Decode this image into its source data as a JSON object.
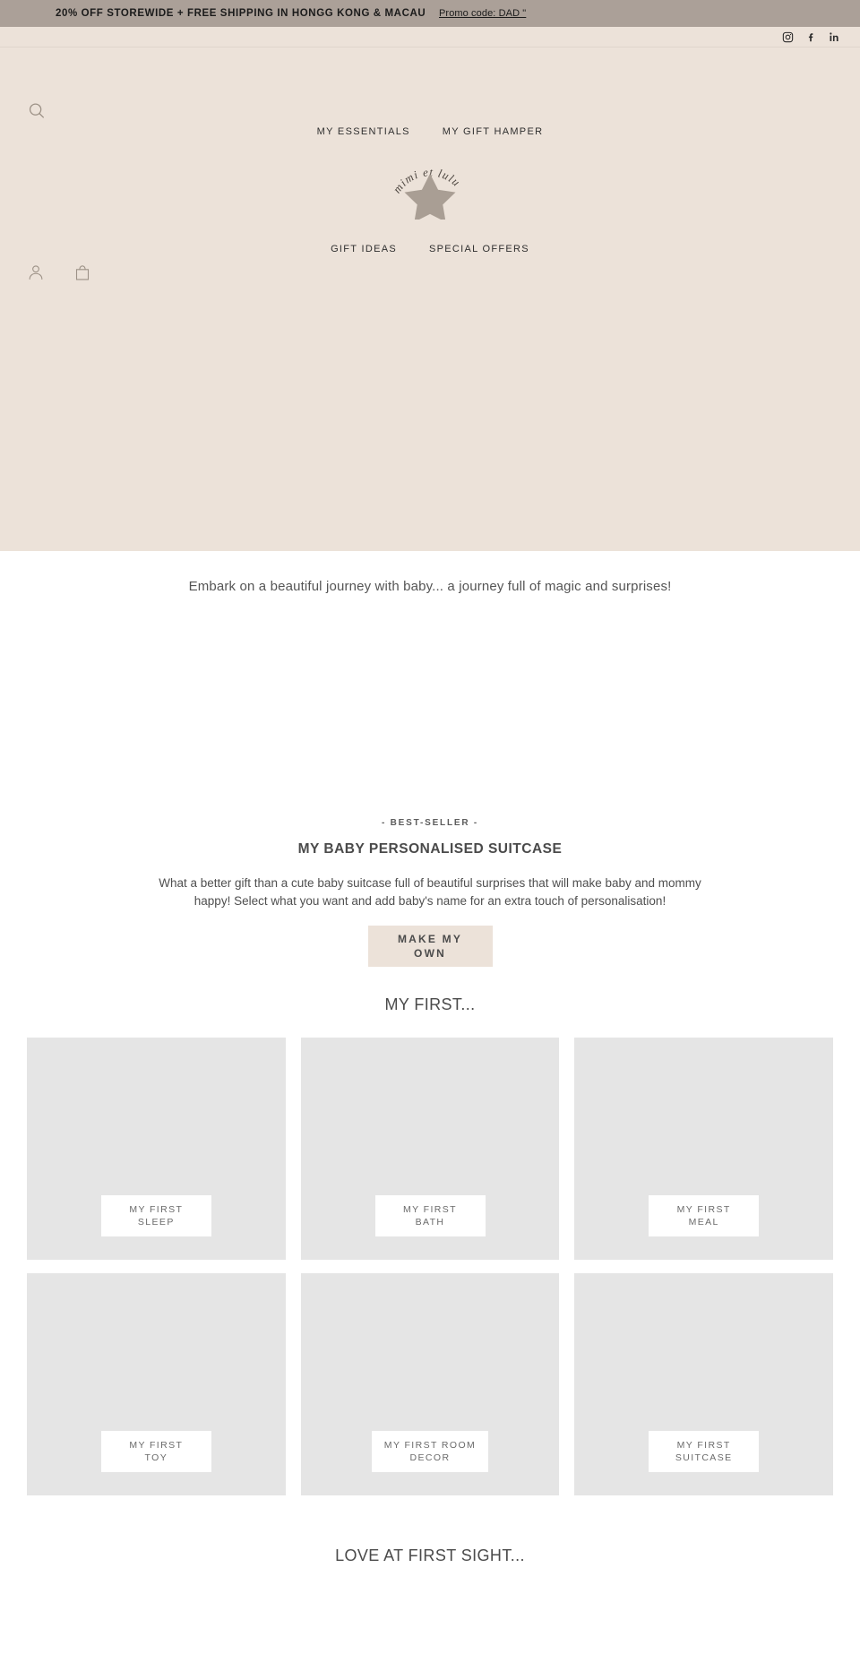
{
  "announcement": {
    "text": "20% OFF STOREWIDE + FREE SHIPPING IN HONGG KONG & MACAU",
    "link_label": "Promo code: DAD \"",
    "background": "#aba098"
  },
  "social": {
    "items": [
      {
        "name": "instagram",
        "label": "Instagram"
      },
      {
        "name": "facebook",
        "label": "Facebook"
      },
      {
        "name": "linkedin",
        "label": "LinkedIn"
      }
    ]
  },
  "header": {
    "background": "#ece2d9",
    "search_label": "Search",
    "account_label": "Account",
    "cart_label": "Cart",
    "logo": {
      "curved_text": "mimi et lulu",
      "shape": "star",
      "color": "#a99e94"
    },
    "nav_top": [
      {
        "label": "MY ESSENTIALS"
      },
      {
        "label": "MY GIFT HAMPER"
      }
    ],
    "nav_bottom": [
      {
        "label": "GIFT IDEAS"
      },
      {
        "label": "SPECIAL OFFERS"
      }
    ]
  },
  "intro": {
    "text": "Embark on a beautiful journey with baby... a journey full of magic and surprises!"
  },
  "bestseller": {
    "eyebrow": "- BEST-SELLER -",
    "title": "MY BABY PERSONALISED SUITCASE",
    "description": "What a better gift than a cute baby suitcase full of beautiful surprises that will make baby and mommy happy! Select what you want and add baby's name for an extra touch of personalisation!",
    "cta_line1": "MAKE MY",
    "cta_line2": "OWN",
    "cta_background": "#ece2d9"
  },
  "my_first": {
    "heading": "MY FIRST...",
    "items": [
      {
        "line1": "MY FIRST",
        "line2": "SLEEP"
      },
      {
        "line1": "MY FIRST",
        "line2": "BATH"
      },
      {
        "line1": "MY FIRST",
        "line2": "MEAL"
      },
      {
        "line1": "MY FIRST",
        "line2": "TOY"
      },
      {
        "line1": "MY FIRST ROOM",
        "line2": "DECOR"
      },
      {
        "line1": "MY FIRST",
        "line2": "SUITCASE"
      }
    ]
  },
  "love_section": {
    "heading": "LOVE AT FIRST SIGHT..."
  }
}
